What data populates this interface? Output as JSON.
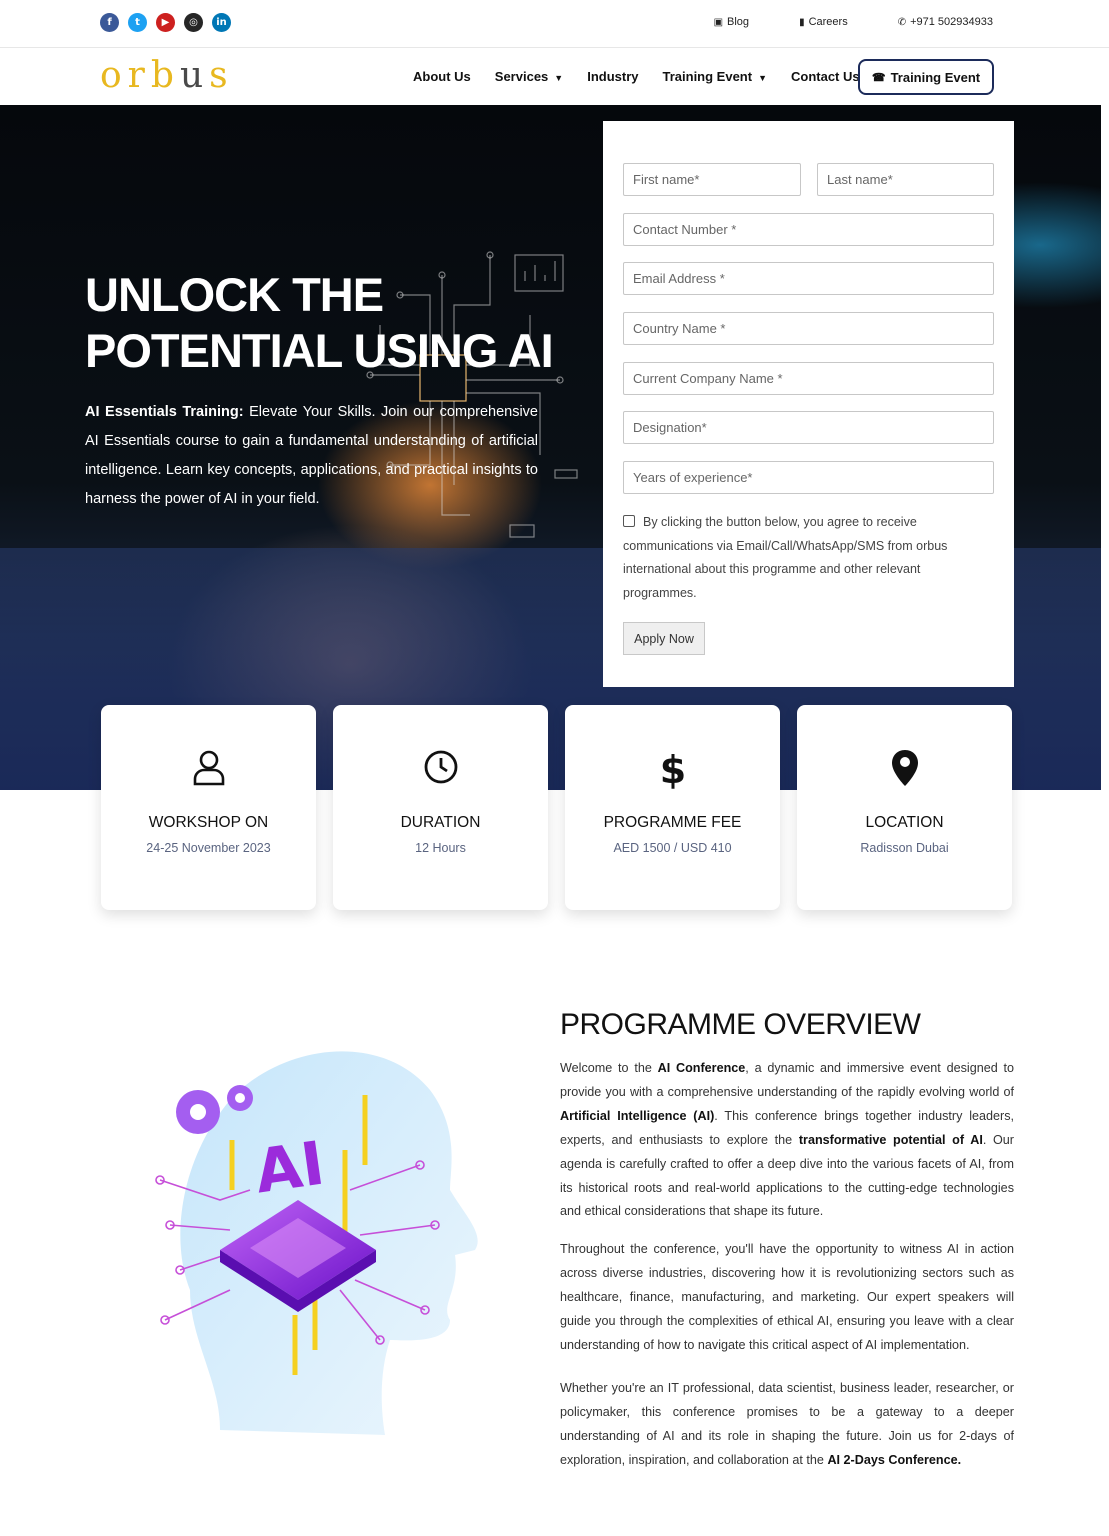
{
  "topbar": {
    "social_icons": [
      "facebook-icon",
      "twitter-icon",
      "youtube-icon",
      "instagram-icon",
      "linkedin-icon"
    ],
    "social_colors": [
      "#3b5998",
      "#1da1f2",
      "#cd201f",
      "#262626",
      "#0077b5"
    ],
    "links": {
      "blog": "Blog",
      "careers": "Careers",
      "phone": "+971 502934933"
    }
  },
  "nav": {
    "logo_prefix": "orb",
    "logo_u": "u",
    "logo_suffix": "s",
    "menu": {
      "about": "About Us",
      "services": "Services",
      "industry": "Industry",
      "training": "Training Event",
      "contact": "Contact Us"
    },
    "cta": "Training Event"
  },
  "hero": {
    "title_line1": "UNLOCK THE",
    "title_line2": "POTENTIAL USING AI",
    "intro_bold": "AI Essentials Training:",
    "intro_text": " Elevate Your Skills. Join our comprehensive AI Essentials course to gain a fundamental understanding of artificial intelligence. Learn key concepts, applications, and practical insights to harness the power of AI in your field."
  },
  "form": {
    "first_name": "First name*",
    "last_name": "Last  name*",
    "contact": "Contact Number *",
    "email": "Email Address *",
    "country": "Country Name *",
    "company": "Current Company Name *",
    "designation": "Designation*",
    "experience": "Years of experience*",
    "consent": "By clicking the button below, you agree to receive communications via Email/Call/WhatsApp/SMS from orbus international about this programme and other relevant programmes.",
    "submit": "Apply Now"
  },
  "info": {
    "workshop": {
      "title": "WORKSHOP ON",
      "value": "24-25 November 2023"
    },
    "duration": {
      "title": "DURATION",
      "value": "12 Hours"
    },
    "fee": {
      "title": "PROGRAMME FEE",
      "value": "AED 1500 / USD 410"
    },
    "location": {
      "title": "LOCATION",
      "value": "Radisson Dubai"
    }
  },
  "overview": {
    "title": "PROGRAMME OVERVIEW",
    "p1": {
      "a": "Welcome to the ",
      "b1": "AI Conference",
      "c": ", a dynamic and immersive event designed to provide you with a comprehensive understanding of the rapidly evolving world of ",
      "b2": "Artificial Intelligence (AI)",
      "d": ". This conference brings together industry leaders, experts, and enthusiasts to explore the ",
      "b3": "transformative potential of AI",
      "e": ". Our agenda is carefully crafted to offer a deep dive into the various facets of AI, from its historical roots and real-world applications to the cutting-edge technologies and ethical considerations that shape its future."
    },
    "p2": "Throughout the conference, you'll have the opportunity to witness AI in action across diverse industries, discovering how it is revolutionizing sectors such as healthcare, finance, manufacturing, and marketing. Our expert speakers will guide you through the complexities of ethical AI, ensuring you leave with a clear understanding of how to navigate this critical aspect of AI implementation.",
    "p3": {
      "a": "Whether you're an IT professional, data scientist, business leader, researcher, or policymaker, this conference promises to be a gateway to a deeper understanding of AI and its role in shaping the future. Join us for 2-days of exploration, inspiration, and collaboration at the ",
      "b": "AI 2-Days Conference."
    },
    "illustration_text": "AI"
  },
  "colors": {
    "accent_navy": "#1c2b5a",
    "logo_gold": "#e8b820",
    "illus_purple": "#8b2be2",
    "illus_yellow": "#f5d020"
  }
}
